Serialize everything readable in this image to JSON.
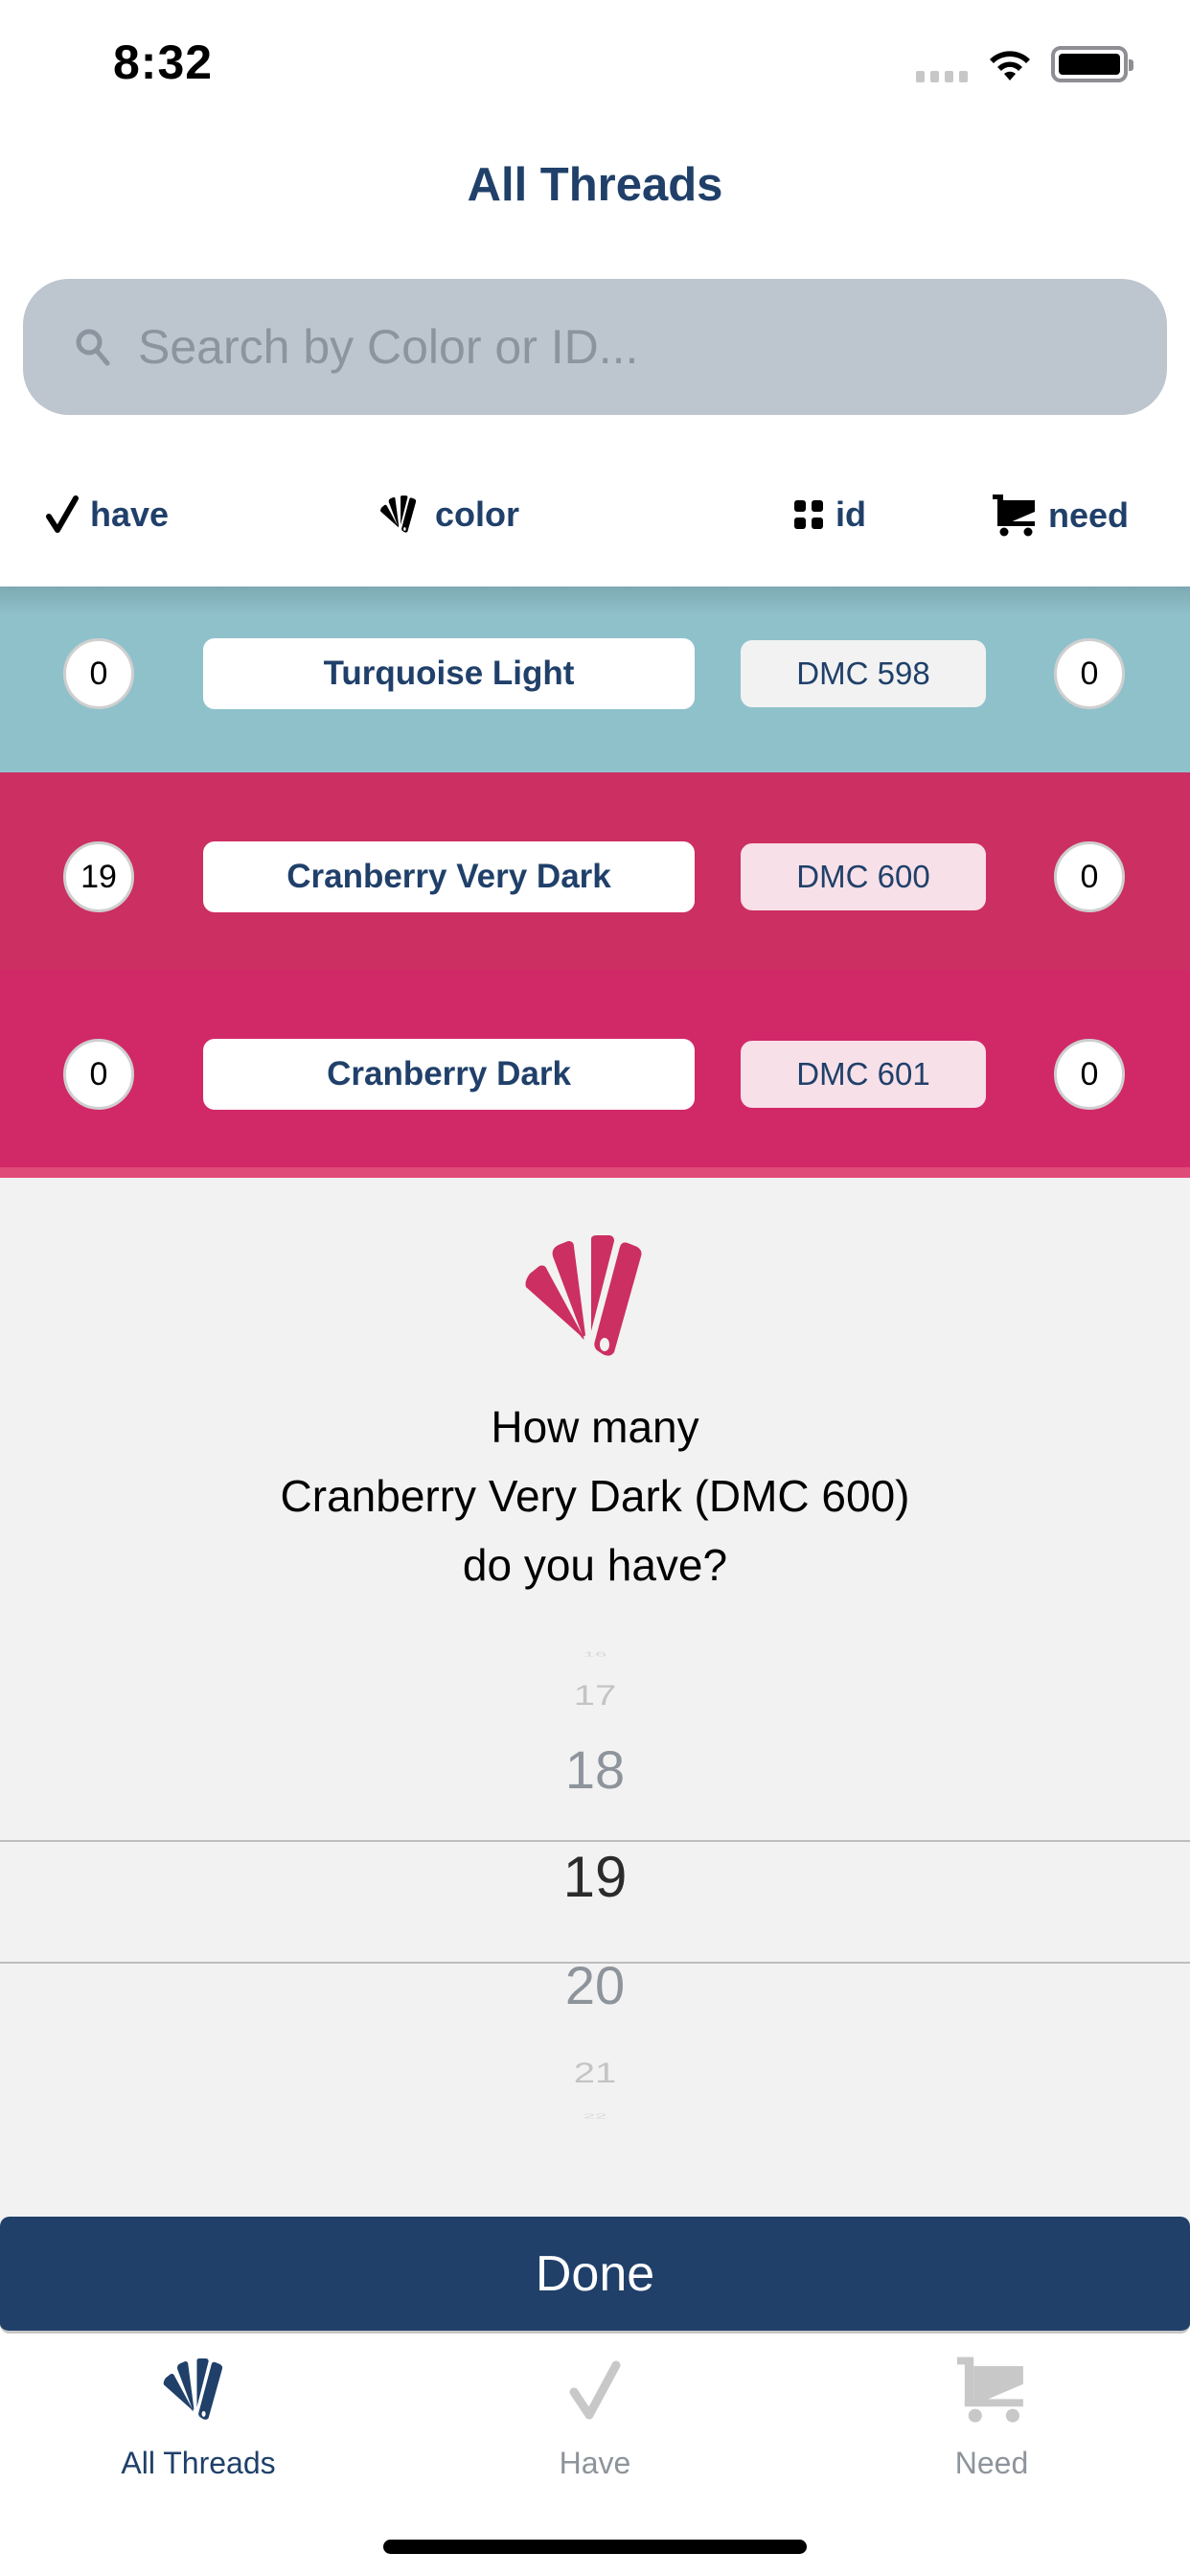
{
  "status_bar": {
    "time": "8:32",
    "icons": [
      "signal-icon",
      "wifi-icon",
      "battery-icon"
    ]
  },
  "header": {
    "title": "All Threads"
  },
  "search": {
    "placeholder": "Search by Color or ID...",
    "value": "",
    "icon": "search-icon"
  },
  "columns": [
    {
      "label": "have",
      "icon": "checkmark-icon"
    },
    {
      "label": "color",
      "icon": "swatch-icon"
    },
    {
      "label": "id",
      "icon": "grid-icon"
    },
    {
      "label": "need",
      "icon": "cart-icon"
    }
  ],
  "threads": [
    {
      "have": "0",
      "name": "Turquoise Light",
      "id": "DMC 598",
      "need": "0",
      "color": "#8fc1cb",
      "id_bg": "#f2f2f2"
    },
    {
      "have": "19",
      "name": "Cranberry Very Dark",
      "id": "DMC 600",
      "need": "0",
      "color": "#cc2f61",
      "id_bg": "#f7e0e8"
    },
    {
      "have": "0",
      "name": "Cranberry Dark",
      "id": "DMC 601",
      "need": "0",
      "color": "#d12868",
      "id_bg": "#f7e0e8"
    },
    {
      "color": "#e04c78"
    }
  ],
  "modal": {
    "icon": "swatch-icon",
    "icon_color": "#cc2f61",
    "question_line1": "How many",
    "question_line2": "Cranberry Very Dark (DMC 600)",
    "question_line3": "do you have?",
    "picker": {
      "options": [
        "16",
        "17",
        "18",
        "19",
        "20",
        "21",
        "22"
      ],
      "selected": "19"
    },
    "done_label": "Done"
  },
  "tabbar": {
    "tabs": [
      {
        "label": "All Threads",
        "icon": "swatch-icon",
        "active": true
      },
      {
        "label": "Have",
        "icon": "checkmark-icon",
        "active": false
      },
      {
        "label": "Need",
        "icon": "cart-icon",
        "active": false
      }
    ]
  },
  "colors": {
    "brand_navy": "#20406a",
    "search_bg": "#bdc5ce",
    "modal_bg": "#f2f2f2",
    "inactive_tab": "#b8b8b8"
  }
}
